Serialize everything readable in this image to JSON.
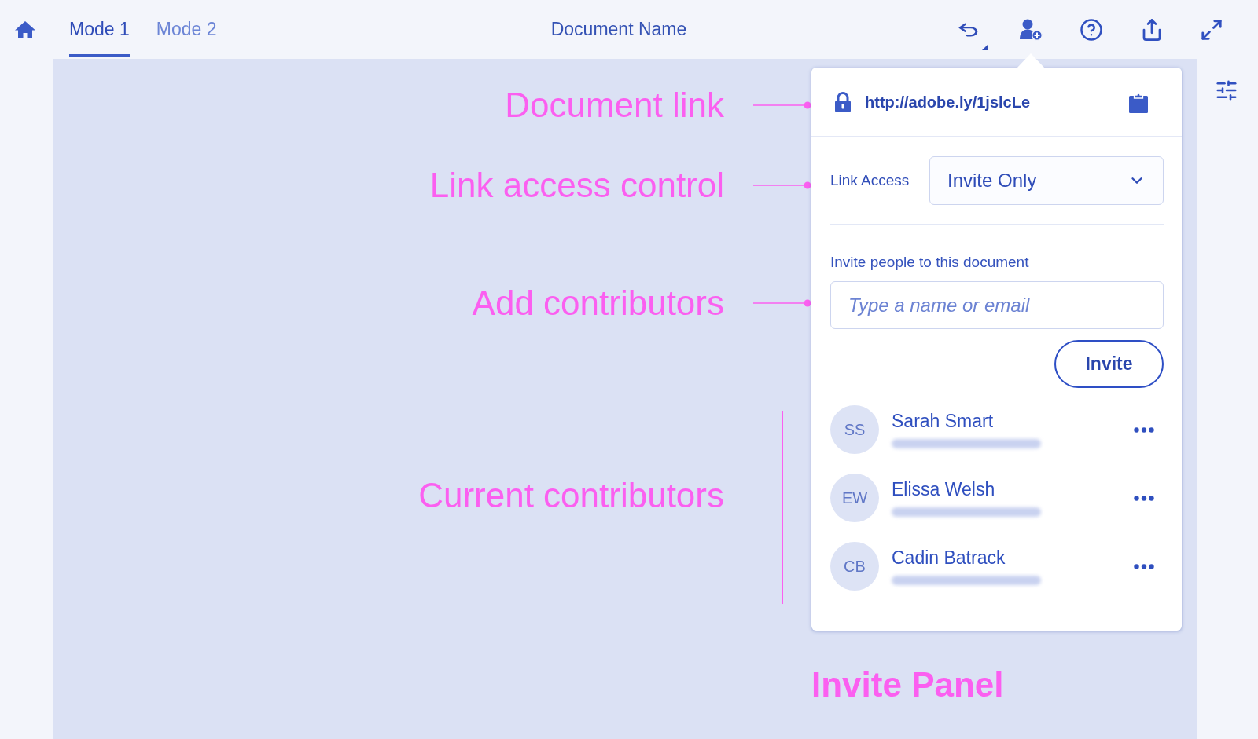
{
  "top_bar": {
    "tabs": [
      {
        "label": "Mode 1",
        "selected": true
      },
      {
        "label": "Mode 2",
        "selected": false
      }
    ],
    "document_title": "Document Name"
  },
  "annotations": [
    {
      "kind": "pointer",
      "text": "Document link"
    },
    {
      "kind": "pointer",
      "text": "Link access control"
    },
    {
      "kind": "pointer",
      "text": "Add contributors"
    },
    {
      "kind": "bracket",
      "text": "Current contributors"
    }
  ],
  "invite_panel": {
    "link_url": "http://adobe.ly/1jslcLe",
    "link_access": {
      "label": "Link Access",
      "value": "Invite Only"
    },
    "invite_heading": "Invite people to this document",
    "invite_field": {
      "placeholder": "Type a name or email"
    },
    "invite_button": "Invite",
    "contributors": [
      {
        "initials": "SS",
        "name": "Sarah Smart"
      },
      {
        "initials": "EW",
        "name": "Elissa Welsh"
      },
      {
        "initials": "CB",
        "name": "Cadin Batrack"
      }
    ]
  },
  "caption": "Invite Panel"
}
